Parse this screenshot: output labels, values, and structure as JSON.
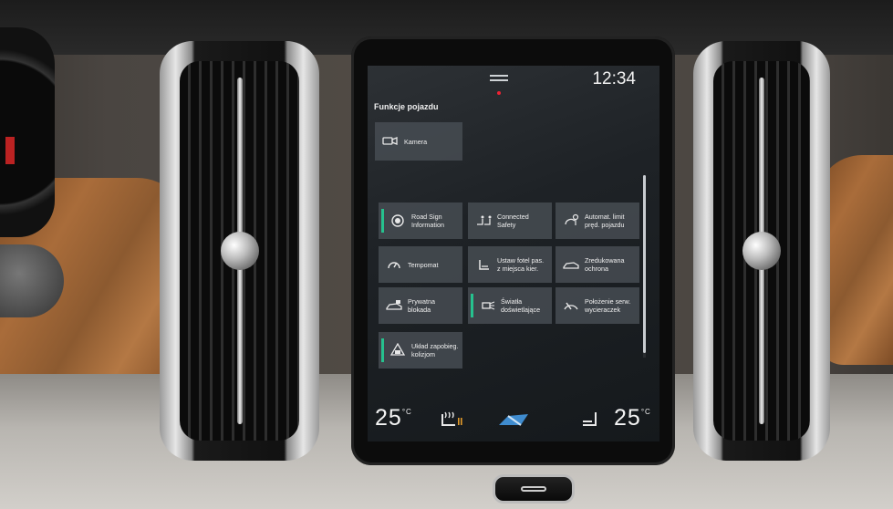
{
  "screen": {
    "clock": "12:34",
    "section_title": "Funkcje pojazdu",
    "camera_tile": {
      "label": "Kamera",
      "icon": "camera-icon"
    },
    "functions": [
      {
        "label": "Road Sign\nInformation",
        "icon": "road-sign-icon",
        "active": true
      },
      {
        "label": "Connected\nSafety",
        "icon": "connected-safety-icon",
        "active": false
      },
      {
        "label": "Automat. limit\npręd. pojazdu",
        "icon": "speed-limit-icon",
        "active": false
      },
      {
        "label": "Tempomat",
        "icon": "cruise-control-icon",
        "active": false
      },
      {
        "label": "Ustaw fotel pas.\nz miejsca kier.",
        "icon": "seat-adjust-icon",
        "active": false
      },
      {
        "label": "Zredukowana\nochrona",
        "icon": "reduced-guard-icon",
        "active": false
      },
      {
        "label": "Prywatna\nblokada",
        "icon": "private-lock-icon",
        "active": false
      },
      {
        "label": "Światła\ndoświetlające",
        "icon": "cornering-lights-icon",
        "active": true
      },
      {
        "label": "Położenie serw.\nwycieraczek",
        "icon": "wiper-service-icon",
        "active": false
      },
      {
        "label": "Układ zapobieg.\nkolizjom",
        "icon": "collision-avoid-icon",
        "active": true
      }
    ],
    "climate": {
      "left_temp": "25",
      "right_temp": "25",
      "unit": "°C"
    },
    "accent_color": "#26c18e"
  }
}
